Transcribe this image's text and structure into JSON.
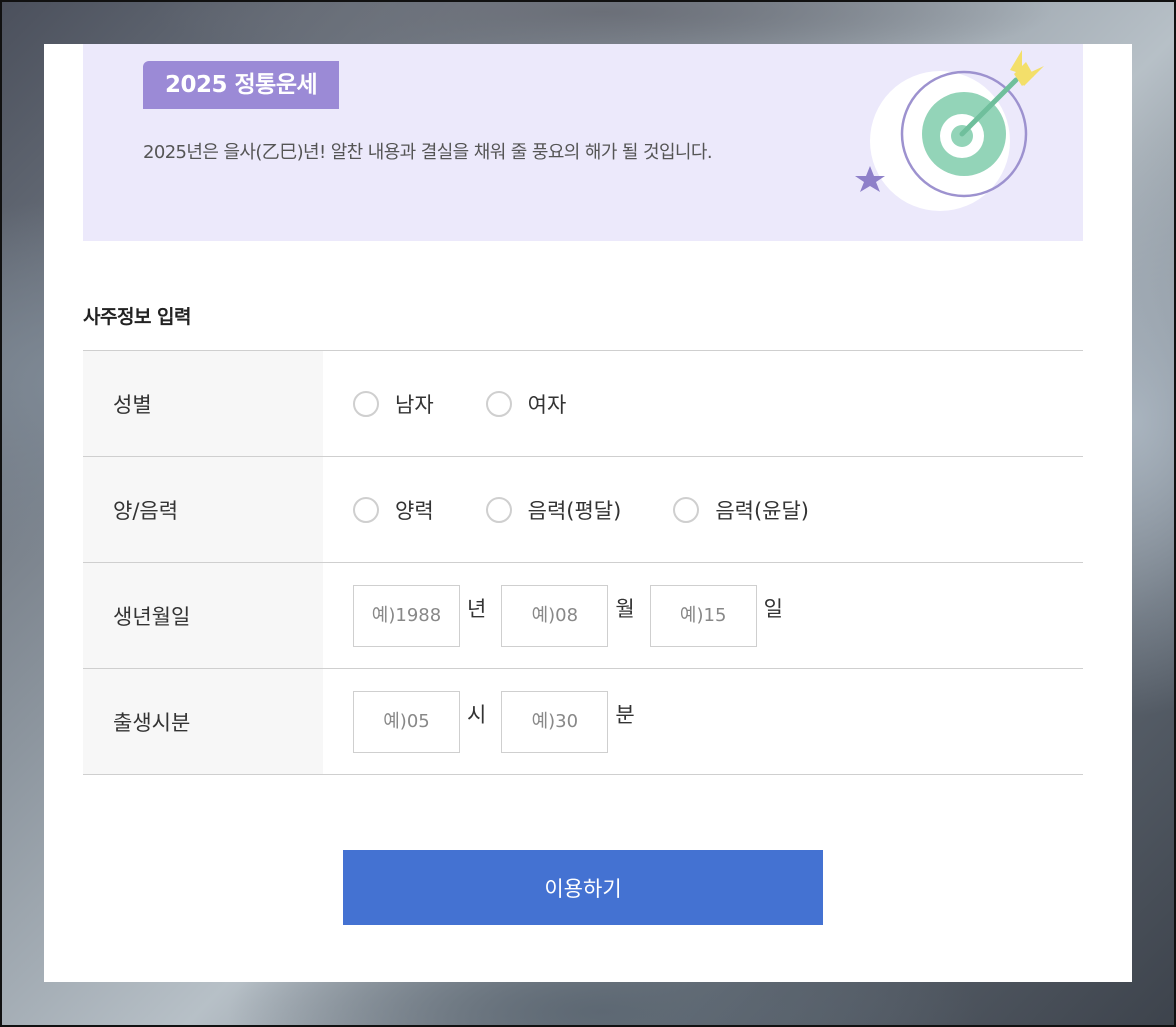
{
  "banner": {
    "tag": "2025 정통운세",
    "description": "2025년은 을사(乙巳)년! 알찬 내용과 결실을 채워 줄 풍요의 해가 될 것입니다."
  },
  "section_title": "사주정보 입력",
  "rows": {
    "gender": {
      "label": "성별",
      "options": [
        "남자",
        "여자"
      ]
    },
    "calendar": {
      "label": "양/음력",
      "options": [
        "양력",
        "음력(평달)",
        "음력(윤달)"
      ]
    },
    "birthdate": {
      "label": "생년월일",
      "year_placeholder": "예)1988",
      "year_unit": "년",
      "month_placeholder": "예)08",
      "month_unit": "월",
      "day_placeholder": "예)15",
      "day_unit": "일"
    },
    "birthtime": {
      "label": "출생시분",
      "hour_placeholder": "예)05",
      "hour_unit": "시",
      "minute_placeholder": "예)30",
      "minute_unit": "분"
    }
  },
  "submit_label": "이용하기",
  "colors": {
    "banner_bg": "#ece9fb",
    "tag_bg": "#9b8ad6",
    "button": "#4472d2",
    "target_green": "#93d4b8",
    "arrow_yellow": "#f3df6a",
    "star_purple": "#8e80c9"
  }
}
